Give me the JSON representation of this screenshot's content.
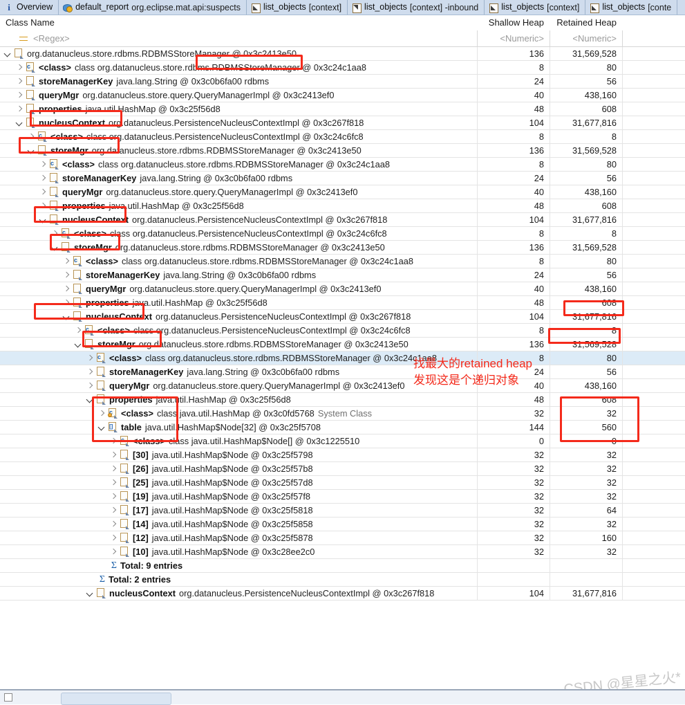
{
  "tabs": [
    {
      "icon": "info-icon",
      "label": "Overview",
      "sub": ""
    },
    {
      "icon": "report-icon",
      "label": "default_report",
      "sub": "org.eclipse.mat.api:suspects"
    },
    {
      "icon": "list-objects-icon",
      "label": "list_objects",
      "sub": "[context]"
    },
    {
      "icon": "list-objects-inbound-icon",
      "label": "list_objects",
      "sub": "[context] -inbound"
    },
    {
      "icon": "list-objects-icon",
      "label": "list_objects",
      "sub": "[context]"
    },
    {
      "icon": "list-objects-icon",
      "label": "list_objects",
      "sub": "[conte"
    }
  ],
  "columns": {
    "class_name": "Class Name",
    "shallow_heap": "Shallow Heap",
    "retained_heap": "Retained Heap"
  },
  "filters": {
    "class_name": "<Regex>",
    "shallow_heap": "<Numeric>",
    "retained_heap": "<Numeric>"
  },
  "annotations": {
    "note_line1": "找最大的retained heap",
    "note_line2": "发现这是个递归对象"
  },
  "watermark": "CSDN @星星之火*",
  "rows": [
    {
      "indent": 0,
      "twisty": "open",
      "icon": "object-icon",
      "name": "",
      "type": "org.datanucleus.store.rdbms.RDBMSStoreManager @ 0x3c2413e50",
      "shallow": "136",
      "retained": "31,569,528"
    },
    {
      "indent": 1,
      "twisty": "closed",
      "icon": "class-icon",
      "name": "<class>",
      "type": "class org.datanucleus.store.rdbms.RDBMSStoreManager @ 0x3c24c1aa8",
      "shallow": "8",
      "retained": "80"
    },
    {
      "indent": 1,
      "twisty": "closed",
      "icon": "object-icon",
      "name": "storeManagerKey",
      "type": "java.lang.String @ 0x3c0b6fa00  rdbms",
      "shallow": "24",
      "retained": "56"
    },
    {
      "indent": 1,
      "twisty": "closed",
      "icon": "object-icon",
      "name": "queryMgr",
      "type": "org.datanucleus.store.query.QueryManagerImpl @ 0x3c2413ef0",
      "shallow": "40",
      "retained": "438,160"
    },
    {
      "indent": 1,
      "twisty": "closed",
      "icon": "object-icon",
      "name": "properties",
      "type": "java.util.HashMap @ 0x3c25f56d8",
      "shallow": "48",
      "retained": "608"
    },
    {
      "indent": 1,
      "twisty": "open",
      "icon": "object-icon",
      "name": "nucleusContext",
      "type": "org.datanucleus.PersistenceNucleusContextImpl @ 0x3c267f818",
      "shallow": "104",
      "retained": "31,677,816"
    },
    {
      "indent": 2,
      "twisty": "closed",
      "icon": "class-icon",
      "name": "<class>",
      "type": "class org.datanucleus.PersistenceNucleusContextImpl @ 0x3c24c6fc8",
      "shallow": "8",
      "retained": "8"
    },
    {
      "indent": 2,
      "twisty": "open",
      "icon": "object-icon",
      "name": "storeMgr",
      "type": "org.datanucleus.store.rdbms.RDBMSStoreManager @ 0x3c2413e50",
      "shallow": "136",
      "retained": "31,569,528"
    },
    {
      "indent": 3,
      "twisty": "closed",
      "icon": "class-icon",
      "name": "<class>",
      "type": "class org.datanucleus.store.rdbms.RDBMSStoreManager @ 0x3c24c1aa8",
      "shallow": "8",
      "retained": "80"
    },
    {
      "indent": 3,
      "twisty": "closed",
      "icon": "object-icon",
      "name": "storeManagerKey",
      "type": "java.lang.String @ 0x3c0b6fa00  rdbms",
      "shallow": "24",
      "retained": "56"
    },
    {
      "indent": 3,
      "twisty": "closed",
      "icon": "object-icon",
      "name": "queryMgr",
      "type": "org.datanucleus.store.query.QueryManagerImpl @ 0x3c2413ef0",
      "shallow": "40",
      "retained": "438,160"
    },
    {
      "indent": 3,
      "twisty": "closed",
      "icon": "object-icon",
      "name": "properties",
      "type": "java.util.HashMap @ 0x3c25f56d8",
      "shallow": "48",
      "retained": "608"
    },
    {
      "indent": 3,
      "twisty": "open",
      "icon": "object-icon",
      "name": "nucleusContext",
      "type": "org.datanucleus.PersistenceNucleusContextImpl @ 0x3c267f818",
      "shallow": "104",
      "retained": "31,677,816"
    },
    {
      "indent": 4,
      "twisty": "closed",
      "icon": "class-icon",
      "name": "<class>",
      "type": "class org.datanucleus.PersistenceNucleusContextImpl @ 0x3c24c6fc8",
      "shallow": "8",
      "retained": "8"
    },
    {
      "indent": 4,
      "twisty": "open",
      "icon": "object-icon",
      "name": "storeMgr",
      "type": "org.datanucleus.store.rdbms.RDBMSStoreManager @ 0x3c2413e50",
      "shallow": "136",
      "retained": "31,569,528"
    },
    {
      "indent": 5,
      "twisty": "closed",
      "icon": "class-icon",
      "name": "<class>",
      "type": "class org.datanucleus.store.rdbms.RDBMSStoreManager @ 0x3c24c1aa8",
      "shallow": "8",
      "retained": "80"
    },
    {
      "indent": 5,
      "twisty": "closed",
      "icon": "object-icon",
      "name": "storeManagerKey",
      "type": "java.lang.String @ 0x3c0b6fa00  rdbms",
      "shallow": "24",
      "retained": "56"
    },
    {
      "indent": 5,
      "twisty": "closed",
      "icon": "object-icon",
      "name": "queryMgr",
      "type": "org.datanucleus.store.query.QueryManagerImpl @ 0x3c2413ef0",
      "shallow": "40",
      "retained": "438,160"
    },
    {
      "indent": 5,
      "twisty": "closed",
      "icon": "object-icon",
      "name": "properties",
      "type": "java.util.HashMap @ 0x3c25f56d8",
      "shallow": "48",
      "retained": "608"
    },
    {
      "indent": 5,
      "twisty": "open",
      "icon": "object-icon",
      "name": "nucleusContext",
      "type": "org.datanucleus.PersistenceNucleusContextImpl @ 0x3c267f818",
      "shallow": "104",
      "retained": "31,677,816"
    },
    {
      "indent": 6,
      "twisty": "closed",
      "icon": "class-icon",
      "name": "<class>",
      "type": "class org.datanucleus.PersistenceNucleusContextImpl @ 0x3c24c6fc8",
      "shallow": "8",
      "retained": "8"
    },
    {
      "indent": 6,
      "twisty": "open",
      "icon": "object-icon",
      "name": "storeMgr",
      "type": "org.datanucleus.store.rdbms.RDBMSStoreManager @ 0x3c2413e50",
      "shallow": "136",
      "retained": "31,569,528"
    },
    {
      "indent": 7,
      "twisty": "closed",
      "icon": "class-icon",
      "name": "<class>",
      "type": "class org.datanucleus.store.rdbms.RDBMSStoreManager @ 0x3c24c1aa8",
      "shallow": "8",
      "retained": "80",
      "selected": true
    },
    {
      "indent": 7,
      "twisty": "closed",
      "icon": "object-icon",
      "name": "storeManagerKey",
      "type": "java.lang.String @ 0x3c0b6fa00  rdbms",
      "shallow": "24",
      "retained": "56"
    },
    {
      "indent": 7,
      "twisty": "closed",
      "icon": "object-icon",
      "name": "queryMgr",
      "type": "org.datanucleus.store.query.QueryManagerImpl @ 0x3c2413ef0",
      "shallow": "40",
      "retained": "438,160"
    },
    {
      "indent": 7,
      "twisty": "open",
      "icon": "object-icon",
      "name": "properties",
      "type": "java.util.HashMap @ 0x3c25f56d8",
      "shallow": "48",
      "retained": "608"
    },
    {
      "indent": 8,
      "twisty": "closed",
      "icon": "system-class-icon",
      "name": "<class>",
      "type": "class java.util.HashMap @ 0x3c0fd5768",
      "suffix": "System Class",
      "shallow": "32",
      "retained": "32"
    },
    {
      "indent": 8,
      "twisty": "open",
      "icon": "array-icon",
      "name": "table",
      "type": "java.util.HashMap$Node[32] @ 0x3c25f5708",
      "shallow": "144",
      "retained": "560"
    },
    {
      "indent": 9,
      "twisty": "closed",
      "icon": "class-icon",
      "name": "<class>",
      "type": "class java.util.HashMap$Node[] @ 0x3c1225510",
      "shallow": "0",
      "retained": "0"
    },
    {
      "indent": 9,
      "twisty": "closed",
      "icon": "object-icon",
      "name": "[30]",
      "type": "java.util.HashMap$Node @ 0x3c25f5798",
      "shallow": "32",
      "retained": "32"
    },
    {
      "indent": 9,
      "twisty": "closed",
      "icon": "object-icon",
      "name": "[26]",
      "type": "java.util.HashMap$Node @ 0x3c25f57b8",
      "shallow": "32",
      "retained": "32"
    },
    {
      "indent": 9,
      "twisty": "closed",
      "icon": "object-icon",
      "name": "[25]",
      "type": "java.util.HashMap$Node @ 0x3c25f57d8",
      "shallow": "32",
      "retained": "32"
    },
    {
      "indent": 9,
      "twisty": "closed",
      "icon": "object-icon",
      "name": "[19]",
      "type": "java.util.HashMap$Node @ 0x3c25f57f8",
      "shallow": "32",
      "retained": "32"
    },
    {
      "indent": 9,
      "twisty": "closed",
      "icon": "object-icon",
      "name": "[17]",
      "type": "java.util.HashMap$Node @ 0x3c25f5818",
      "shallow": "32",
      "retained": "64"
    },
    {
      "indent": 9,
      "twisty": "closed",
      "icon": "object-icon",
      "name": "[14]",
      "type": "java.util.HashMap$Node @ 0x3c25f5858",
      "shallow": "32",
      "retained": "32"
    },
    {
      "indent": 9,
      "twisty": "closed",
      "icon": "object-icon",
      "name": "[12]",
      "type": "java.util.HashMap$Node @ 0x3c25f5878",
      "shallow": "32",
      "retained": "160"
    },
    {
      "indent": 9,
      "twisty": "closed",
      "icon": "object-icon",
      "name": "[10]",
      "type": "java.util.HashMap$Node @ 0x3c28ee2c0",
      "shallow": "32",
      "retained": "32"
    },
    {
      "indent": 8,
      "twisty": "none",
      "icon": "sigma-icon",
      "name": "Total: 9 entries",
      "type": "",
      "shallow": "",
      "retained": ""
    },
    {
      "indent": 7,
      "twisty": "none",
      "icon": "sigma-icon",
      "name": "Total: 2 entries",
      "type": "",
      "shallow": "",
      "retained": ""
    },
    {
      "indent": 7,
      "twisty": "open",
      "icon": "object-icon",
      "name": "nucleusContext",
      "type": "org.datanucleus.PersistenceNucleusContextImpl @ 0x3c267f818",
      "shallow": "104",
      "retained": "31,677,816"
    }
  ]
}
